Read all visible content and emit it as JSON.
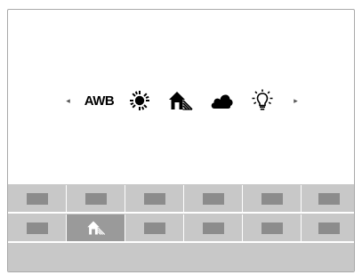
{
  "wb_selector": {
    "left_arrow": "◂",
    "right_arrow": "▸",
    "items": [
      {
        "label": "AWB",
        "icon": "awb-text"
      },
      {
        "icon": "daylight-sun-icon"
      },
      {
        "icon": "shade-house-icon"
      },
      {
        "icon": "cloudy-icon"
      },
      {
        "icon": "tungsten-bulb-icon"
      }
    ]
  },
  "palette": {
    "rows": 2,
    "columns": 6,
    "selected": {
      "row": 2,
      "column": 2,
      "icon": "shade-house-icon"
    }
  },
  "colors": {
    "background": "#ffffff",
    "panel": "#c8c8c8",
    "swatch": "#8c8c8c",
    "selected_cell": "#9a9a9a",
    "icon": "#000000"
  }
}
